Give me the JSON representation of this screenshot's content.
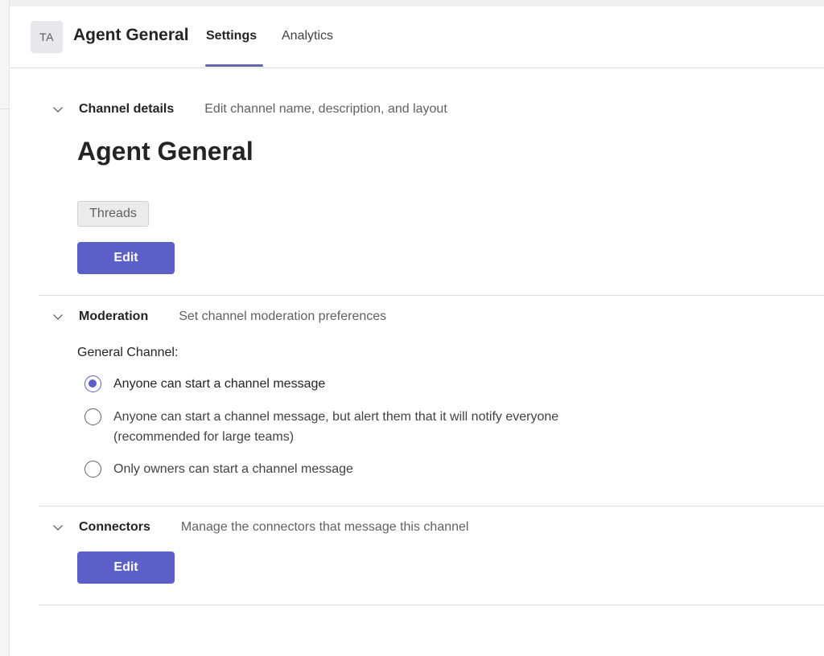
{
  "header": {
    "avatar_initials": "TA",
    "title": "Agent General",
    "tabs": [
      {
        "label": "Settings",
        "active": true
      },
      {
        "label": "Analytics",
        "active": false
      }
    ]
  },
  "channel_details": {
    "title": "Channel details",
    "description": "Edit channel name, description, and layout",
    "channel_name": "Agent General",
    "layout_tag": "Threads",
    "edit_label": "Edit"
  },
  "moderation": {
    "title": "Moderation",
    "description": "Set channel moderation preferences",
    "group_label": "General Channel:",
    "options": [
      {
        "label": "Anyone can start a channel message",
        "selected": true
      },
      {
        "label": "Anyone can start a channel message, but alert them that it will notify everyone (recommended for large teams)",
        "selected": false
      },
      {
        "label": "Only owners can start a channel message",
        "selected": false
      }
    ]
  },
  "connectors": {
    "title": "Connectors",
    "description": "Manage the connectors that message this channel",
    "edit_label": "Edit"
  },
  "colors": {
    "accent": "#5b5fc7",
    "tab_underline": "#6264a7"
  },
  "icons": {
    "section_toggle": "chevron-down-icon"
  }
}
